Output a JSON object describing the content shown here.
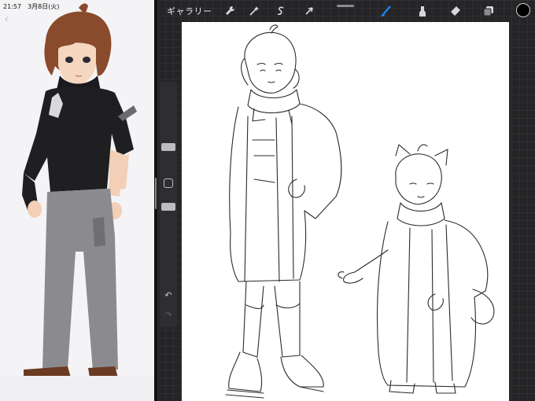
{
  "status_bar": {
    "time": "21:57",
    "date": "3月8日(火)"
  },
  "left_pane": {
    "back_icon": "chevron-left-icon"
  },
  "toolbar": {
    "gallery_label": "ギャラリー",
    "actions_icon": "wrench-icon",
    "adjustments_icon": "magic-wand-icon",
    "selection_icon": "selection-s-icon",
    "transform_icon": "arrow-cursor-icon",
    "brush_icon": "brush-icon",
    "smudge_icon": "smudge-icon",
    "eraser_icon": "eraser-icon",
    "layers_icon": "layers-icon",
    "current_color": "#000000",
    "accent_color": "#1a8cff"
  },
  "sidebar": {
    "size_slider_icon": "size-slider",
    "modify_icon": "square-modify-icon",
    "opacity_slider_icon": "opacity-slider",
    "undo_icon": "undo-icon",
    "redo_icon": "redo-icon"
  }
}
